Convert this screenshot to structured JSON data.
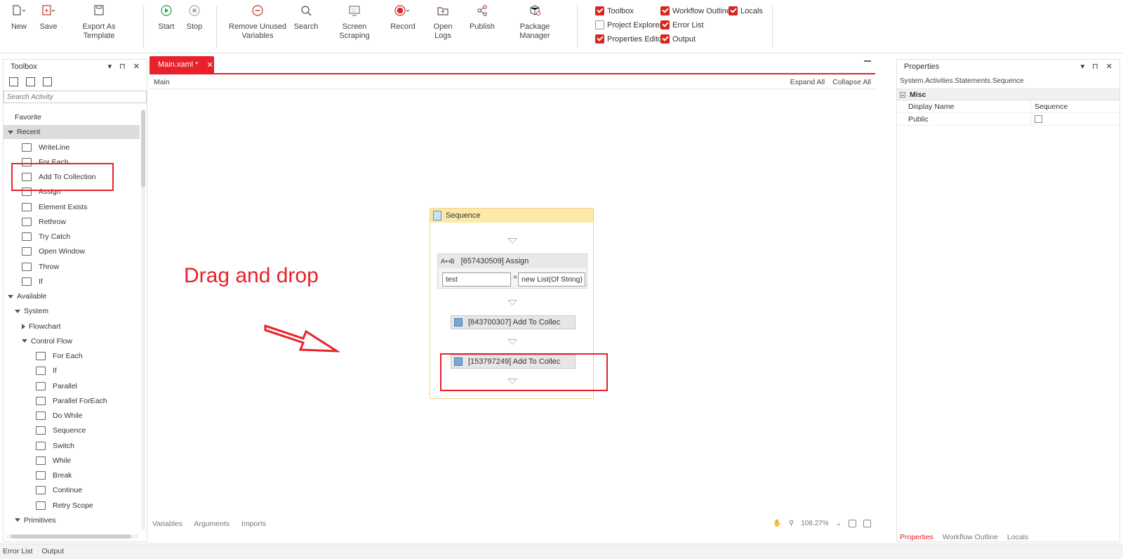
{
  "ribbon": {
    "new_label": "New",
    "save_label": "Save",
    "export_label": "Export As Template",
    "start_label": "Start",
    "stop_label": "Stop",
    "remove_unused_label_1": "Remove Unused",
    "remove_unused_label_2": "Variables",
    "search_label": "Search",
    "screen_scraping_label": "Screen Scraping",
    "record_label": "Record",
    "open_logs_label": "Open Logs",
    "publish_label": "Publish",
    "package_manager_label": "Package Manager"
  },
  "panels_toggle": {
    "toolbox": {
      "label": "Toolbox",
      "checked": true
    },
    "workflow_outline": {
      "label": "Workflow Outline",
      "checked": true
    },
    "locals": {
      "label": "Locals",
      "checked": true
    },
    "project_explorer": {
      "label": "Project Explorer",
      "checked": false
    },
    "error_list": {
      "label": "Error List",
      "checked": true
    },
    "properties_editor": {
      "label": "Properties Editor",
      "checked": true
    },
    "output": {
      "label": "Output",
      "checked": true
    }
  },
  "toolbox": {
    "title": "Toolbox",
    "search_placeholder": "Search Activity",
    "items": [
      {
        "label": "Favorite",
        "level": 0,
        "arrow": "none"
      },
      {
        "label": "Recent",
        "level": 0,
        "arrow": "down",
        "selected": true
      },
      {
        "label": "WriteLine",
        "level": 2,
        "icon": true
      },
      {
        "label": "For Each",
        "level": 2,
        "icon": true
      },
      {
        "label": "Add To Collection",
        "level": 2,
        "icon": true
      },
      {
        "label": "Assign",
        "level": 2,
        "icon": true
      },
      {
        "label": "Element Exists",
        "level": 2,
        "icon": true
      },
      {
        "label": "Rethrow",
        "level": 2,
        "icon": true
      },
      {
        "label": "Try Catch",
        "level": 2,
        "icon": true
      },
      {
        "label": "Open Window",
        "level": 2,
        "icon": true
      },
      {
        "label": "Throw",
        "level": 2,
        "icon": true
      },
      {
        "label": "If",
        "level": 2,
        "icon": true
      },
      {
        "label": "Available",
        "level": 0,
        "arrow": "down"
      },
      {
        "label": "System",
        "level": 1,
        "arrow": "down"
      },
      {
        "label": "Flowchart",
        "level": 2,
        "arrow": "right"
      },
      {
        "label": "Control Flow",
        "level": 2,
        "arrow": "down"
      },
      {
        "label": "For Each",
        "level": 3,
        "icon": true
      },
      {
        "label": "If",
        "level": 3,
        "icon": true
      },
      {
        "label": "Parallel",
        "level": 3,
        "icon": true
      },
      {
        "label": "Parallel ForEach",
        "level": 3,
        "icon": true
      },
      {
        "label": "Do While",
        "level": 3,
        "icon": true
      },
      {
        "label": "Sequence",
        "level": 3,
        "icon": true
      },
      {
        "label": "Switch",
        "level": 3,
        "icon": true
      },
      {
        "label": "While",
        "level": 3,
        "icon": true
      },
      {
        "label": "Break",
        "level": 3,
        "icon": true
      },
      {
        "label": "Continue",
        "level": 3,
        "icon": true
      },
      {
        "label": "Retry Scope",
        "level": 3,
        "icon": true
      },
      {
        "label": "Primitives",
        "level": 1,
        "arrow": "down"
      }
    ]
  },
  "designer": {
    "tab_label": "Main.xaml *",
    "breadcrumb": "Main",
    "expand_all": "Expand All",
    "collapse_all": "Collapse All",
    "sequence_title": "Sequence",
    "assign_title": "[657430509] Assign",
    "assign_to": "test",
    "assign_eq": "=",
    "assign_value": "new List(Of String)",
    "activity_1": "[843700307] Add To Collec",
    "activity_2": "[153797249] Add To Collec",
    "annotation_text": "Drag and drop",
    "bottom_tabs": [
      "Variables",
      "Arguments",
      "Imports"
    ],
    "zoom_level": "108.27%"
  },
  "properties": {
    "title": "Properties",
    "type_name": "System.Activities.Statements.Sequence",
    "category": "Misc",
    "rows": [
      {
        "name": "Display Name",
        "value": "Sequence"
      },
      {
        "name": "Public",
        "value": ""
      }
    ],
    "tabs": [
      "Properties",
      "Workflow Outline",
      "Locals"
    ]
  },
  "statusbar": {
    "tabs": [
      "Error List",
      "Output"
    ]
  },
  "colors": {
    "accent": "#e8212a",
    "sequence_header": "#fce9a8"
  }
}
